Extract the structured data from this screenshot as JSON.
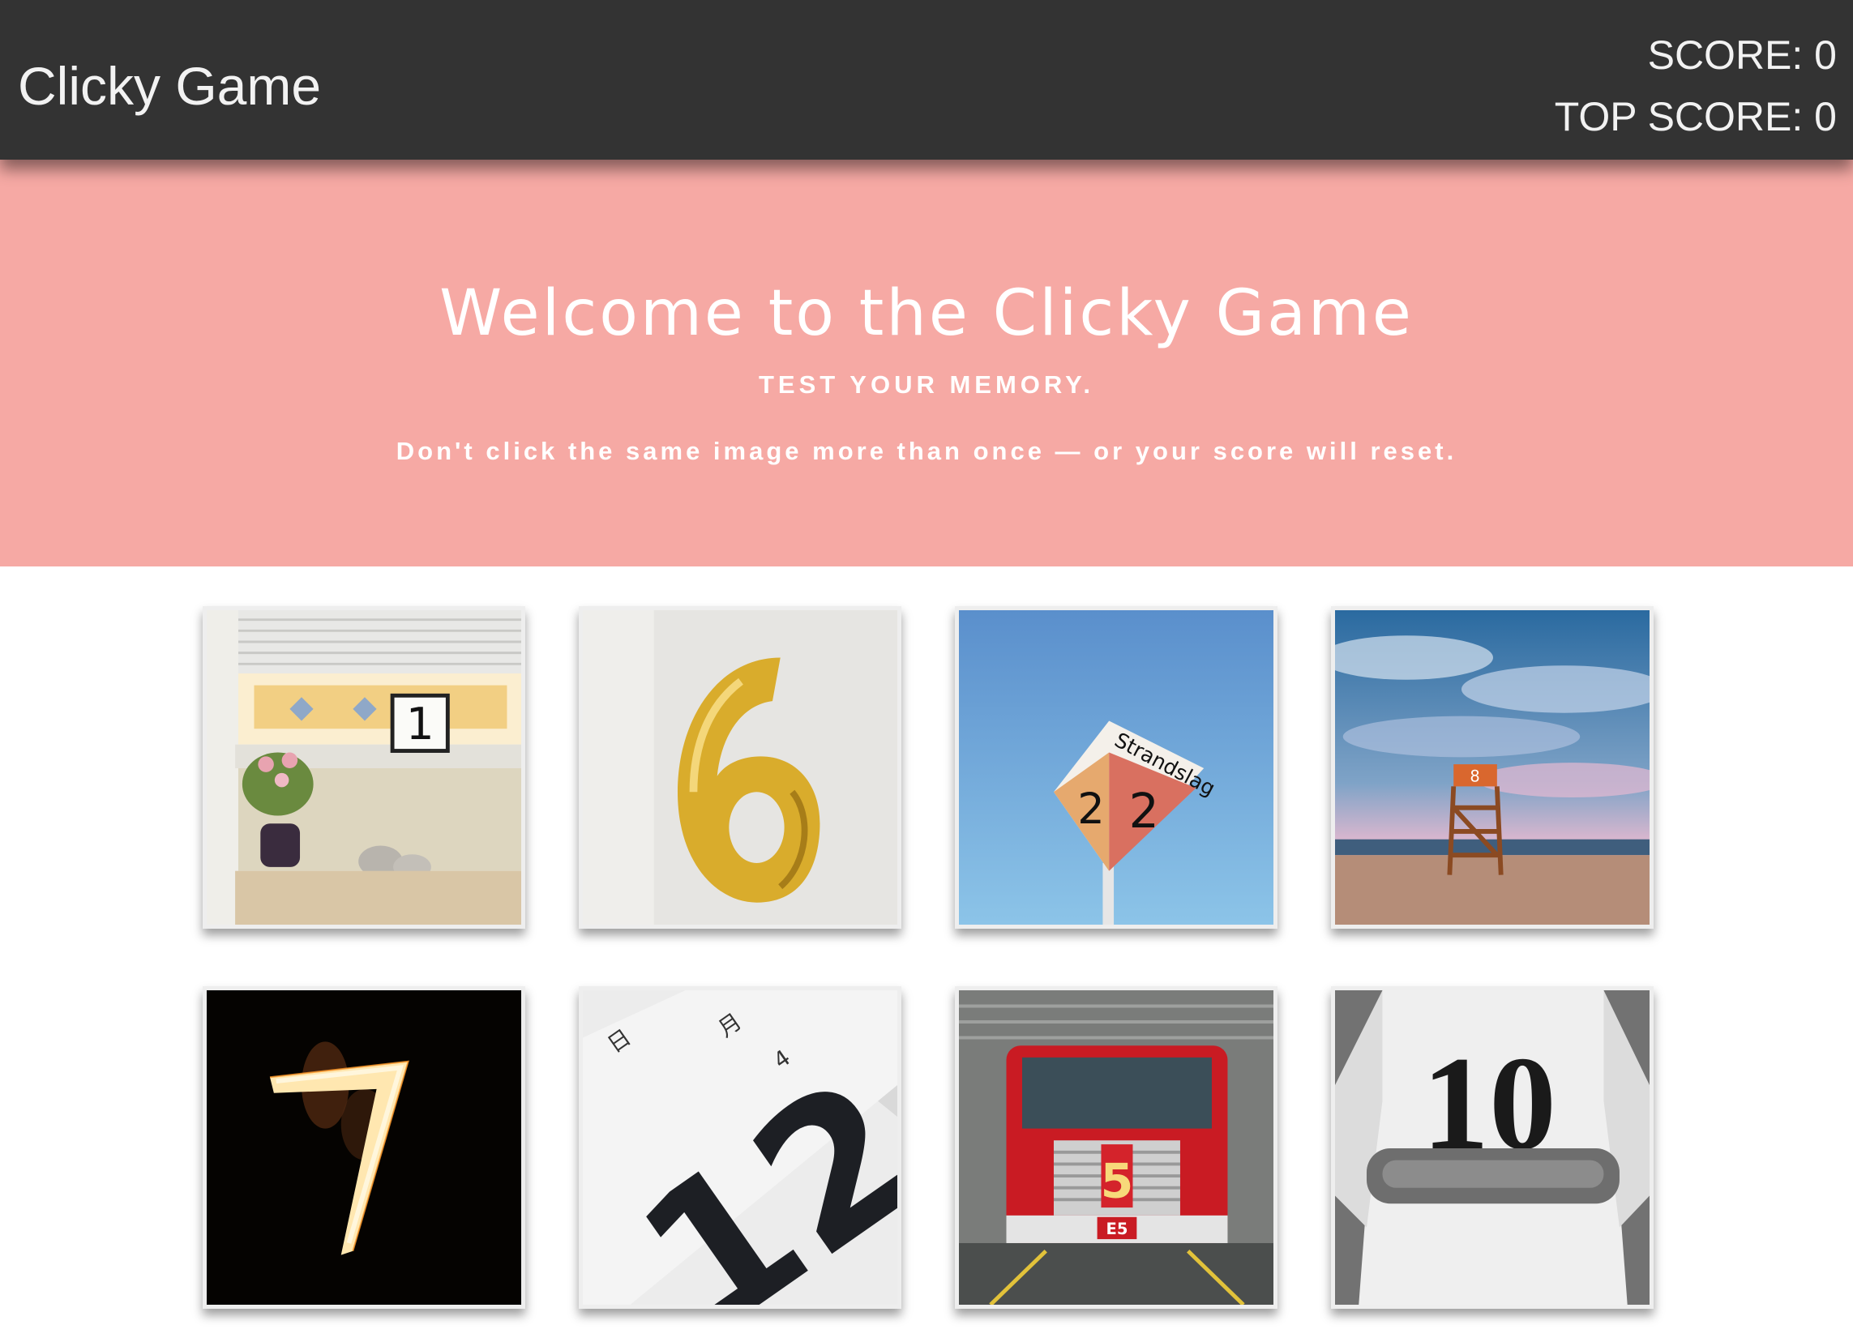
{
  "navbar": {
    "brand": "Clicky Game",
    "score_label": "SCORE: 0",
    "top_score_label": "TOP SCORE: 0"
  },
  "hero": {
    "title": "Welcome to the Clicky Game",
    "subtitle": "TEST YOUR MEMORY.",
    "note": "Don't click the same image more than once — or your score will reset."
  },
  "cards": [
    {
      "icon": "number-1-windowsill-image",
      "text": "1"
    },
    {
      "icon": "number-6-balloon-image",
      "text": "6"
    },
    {
      "icon": "number-22-sign-image",
      "text": "Strandslag",
      "text2": "2",
      "text3": "2"
    },
    {
      "icon": "number-8-lifeguard-chair-image",
      "text": "8"
    },
    {
      "icon": "number-7-fire-image",
      "text": "7"
    },
    {
      "icon": "number-12-calendar-image",
      "text": "12"
    },
    {
      "icon": "number-5-fire-truck-image",
      "text": "5",
      "text2": "E5"
    },
    {
      "icon": "number-10-jersey-image",
      "text": "10"
    }
  ],
  "colors": {
    "navbar": "#333333",
    "hero": "#f6a9a4",
    "text_light": "#ffffff"
  }
}
